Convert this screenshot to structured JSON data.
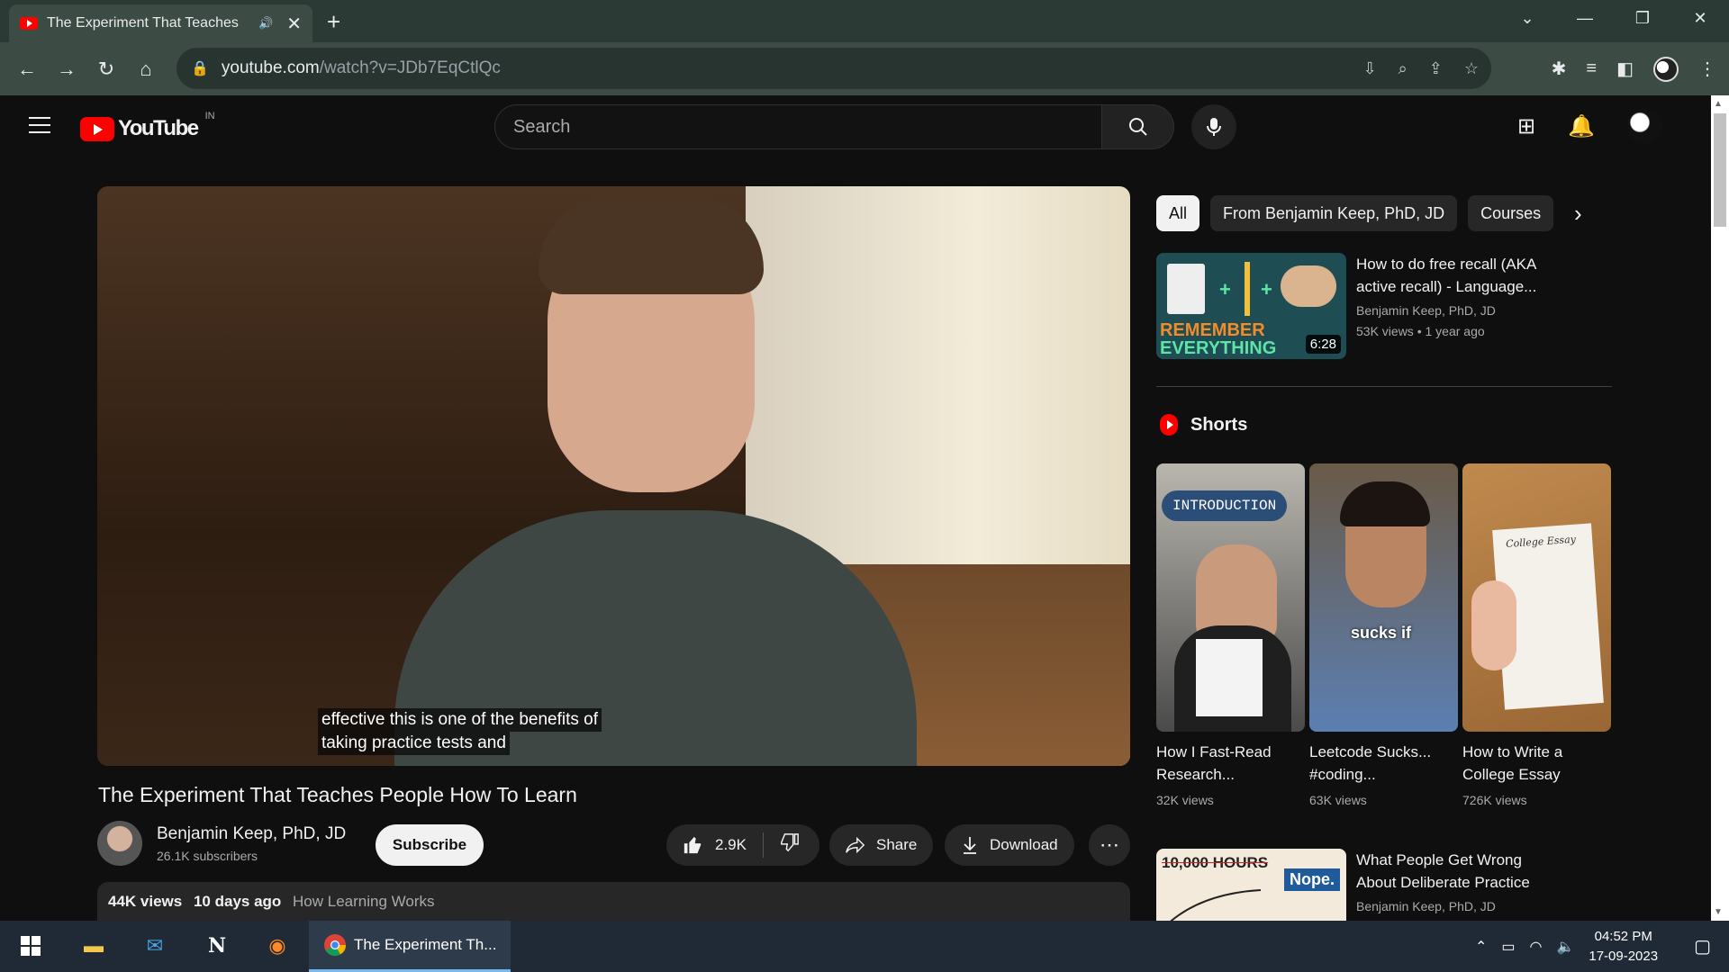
{
  "browser": {
    "tab_title": "The Experiment That Teaches",
    "url_host": "youtube.com",
    "url_path": "/watch?v=JDb7EqCtlQc"
  },
  "header": {
    "logo_text": "YouTube",
    "country_code": "IN",
    "search_placeholder": "Search"
  },
  "video": {
    "caption_line1": "effective this is one of the benefits of",
    "caption_line2": "taking practice tests and",
    "title": "The Experiment That Teaches People How To Learn",
    "channel": "Benjamin Keep, PhD, JD",
    "subscribers": "26.1K subscribers",
    "subscribe_label": "Subscribe",
    "likes": "2.9K",
    "share_label": "Share",
    "download_label": "Download",
    "views": "44K views",
    "age": "10 days ago",
    "tag": "How Learning Works"
  },
  "sidebar": {
    "chips": [
      "All",
      "From Benjamin Keep, PhD, JD",
      "Courses"
    ],
    "rec1": {
      "title": "How to do free recall (AKA active recall) - Language...",
      "channel": "Benjamin Keep, PhD, JD",
      "meta": "53K views  • 1 year ago",
      "duration": "6:28",
      "thumb_text1": "REMEMBER",
      "thumb_text2": "EVERYTHING"
    },
    "shorts_label": "Shorts",
    "shorts": [
      {
        "title": "How I Fast-Read Research...",
        "views": "32K views",
        "overlay": "INTRODUCTION"
      },
      {
        "title": "Leetcode Sucks... #coding...",
        "views": "63K views",
        "overlay": "sucks if"
      },
      {
        "title": "How to Write a College Essay",
        "views": "726K views",
        "overlay": "College Essay"
      }
    ],
    "rec2": {
      "title": "What People Get Wrong About Deliberate Practice",
      "channel": "Benjamin Keep, PhD, JD",
      "thumb_text1": "10,000 HOURS",
      "thumb_text2": "Nope."
    }
  },
  "taskbar": {
    "active_label": "The Experiment Th...",
    "time": "04:52 PM",
    "date": "17-09-2023"
  },
  "colors": {
    "accent_red": "#ff0000",
    "bg": "#0f0f0f",
    "chrome_frame": "#2b3a34"
  }
}
